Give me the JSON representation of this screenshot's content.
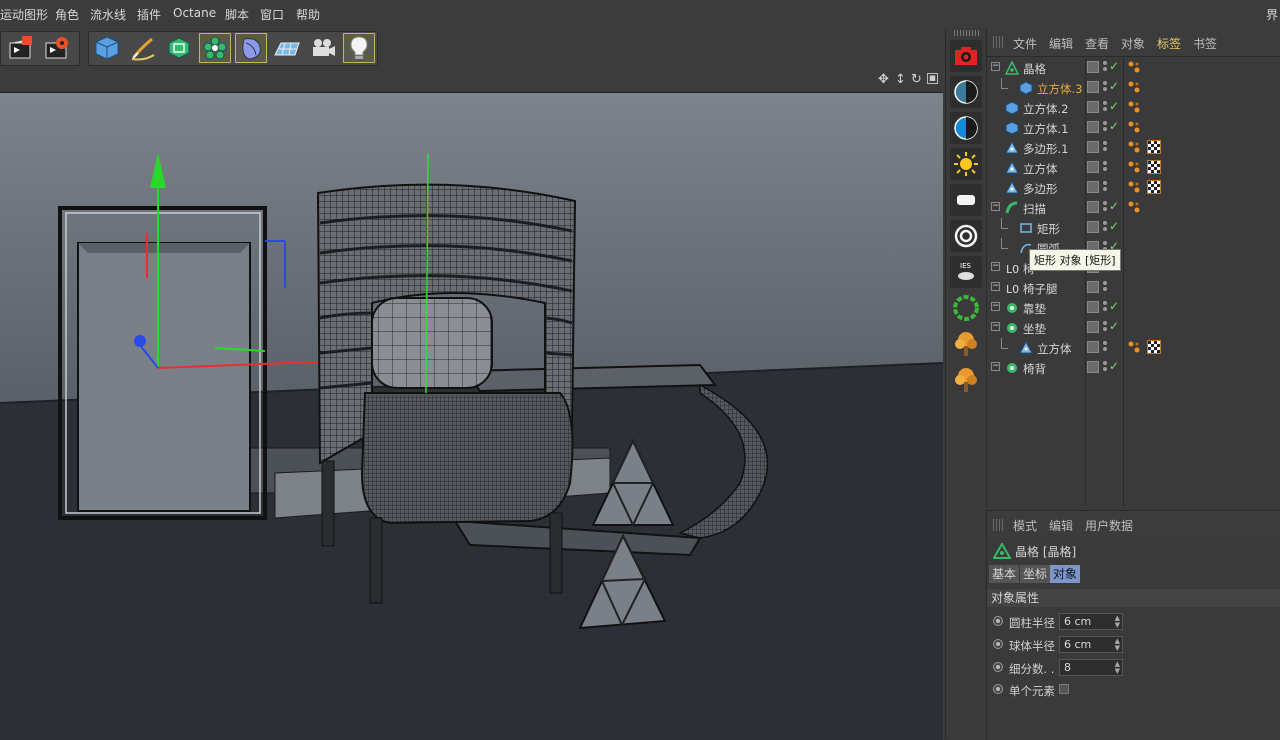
{
  "menu": [
    "运动图形",
    "角色",
    "流水线",
    "插件",
    "Octane",
    "脚本",
    "窗口",
    "帮助"
  ],
  "menu_right": "界",
  "toolbar": {
    "icons": [
      "render-clapper-icon",
      "render-settings-icon",
      "cube-icon",
      "pen-icon",
      "subdivision-icon",
      "cloner-icon",
      "deformer-icon",
      "floor-icon",
      "camera-icon",
      "light-bulb-icon"
    ]
  },
  "viewport": {
    "nav_icons": [
      "move-view-icon",
      "zoom-view-icon",
      "rotate-view-icon",
      "maximize-view-icon"
    ]
  },
  "right_column_icons": [
    "octane-render-icon",
    "octane-daylight-icon",
    "octane-environment-icon",
    "octane-sun-icon",
    "octane-area-light-icon",
    "octane-target-light-icon",
    "octane-ies-light-icon",
    "octane-scatter-icon",
    "octane-tree-icon",
    "octane-tree-2-icon"
  ],
  "object_manager": {
    "tabs": [
      "文件",
      "编辑",
      "查看",
      "对象",
      "标签",
      "书签"
    ],
    "active_tab": "标签",
    "objects": [
      {
        "name": "晶格",
        "icon": "lattice-icon",
        "check": "✓",
        "tags": [
          "phong"
        ]
      },
      {
        "name": "立方体.3",
        "icon": "cube-icon",
        "check": "✓",
        "tags": [
          "phong"
        ],
        "highlight": true
      },
      {
        "name": "立方体.2",
        "icon": "cube-icon",
        "check": "✓",
        "tags": [
          "phong"
        ]
      },
      {
        "name": "立方体.1",
        "icon": "cube-icon",
        "check": "✓",
        "tags": [
          "phong"
        ]
      },
      {
        "name": "多边形.1",
        "icon": "polygon-icon",
        "check": "",
        "tags": [
          "phong",
          "texture"
        ]
      },
      {
        "name": "立方体",
        "icon": "polygon-icon",
        "check": "",
        "tags": [
          "phong",
          "texture"
        ]
      },
      {
        "name": "多边形",
        "icon": "polygon-icon",
        "check": "",
        "tags": [
          "phong",
          "texture"
        ]
      },
      {
        "name": "扫描",
        "icon": "sweep-icon",
        "check": "✓",
        "tags": [
          "phong"
        ]
      },
      {
        "name": "矩形",
        "icon": "rectangle-spline-icon",
        "check": "✓",
        "tags": []
      },
      {
        "name": "圆弧",
        "icon": "arc-spline-icon",
        "check": "✓",
        "tags": []
      },
      {
        "name": "椅",
        "icon": "null-icon",
        "check": "",
        "tags": []
      },
      {
        "name": "椅子腿",
        "icon": "null-icon",
        "check": "",
        "tags": []
      },
      {
        "name": "靠垫",
        "icon": "subdivision-icon",
        "check": "✓",
        "tags": []
      },
      {
        "name": "坐垫",
        "icon": "subdivision-icon",
        "check": "✓",
        "tags": []
      },
      {
        "name": "立方体",
        "icon": "polygon-icon",
        "check": "",
        "tags": [
          "phong",
          "texture"
        ]
      },
      {
        "name": "椅背",
        "icon": "subdivision-icon",
        "check": "✓",
        "tags": []
      }
    ],
    "tooltip": "矩形 对象 [矩形]"
  },
  "attributes": {
    "tabs": [
      "模式",
      "编辑",
      "用户数据"
    ],
    "title": "晶格 [晶格]",
    "subtabs": [
      "基本",
      "坐标",
      "对象"
    ],
    "active_subtab": "对象",
    "section": "对象属性",
    "fields": [
      {
        "label": "圆柱半径",
        "value": "6 cm"
      },
      {
        "label": "球体半径",
        "value": "6 cm"
      },
      {
        "label": "细分数. .",
        "value": "8"
      }
    ],
    "checkbox_label": "单个元素"
  },
  "colors": {
    "accent": "#e8c860",
    "highlight_orange": "#e8a848",
    "check_green": "#7dd86a",
    "viewport_bg": "#5d6269"
  }
}
